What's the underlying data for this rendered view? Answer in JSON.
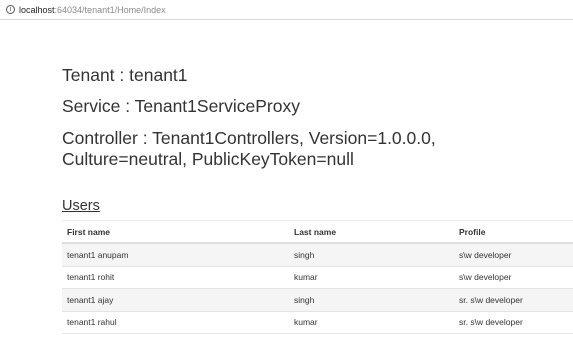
{
  "browser": {
    "url_host": "localhost",
    "url_rest": ":64034/tenant1/Home/Index",
    "info_icon": "info-icon"
  },
  "page": {
    "tenant_line": "Tenant : tenant1",
    "service_line": "Service : Tenant1ServiceProxy",
    "controller_line": "Controller : Tenant1Controllers, Version=1.0.0.0, Culture=neutral, PublicKeyToken=null",
    "users_heading": "Users"
  },
  "table": {
    "headers": [
      "First name",
      "Last name",
      "Profile"
    ],
    "rows": [
      [
        "tenant1 anupam",
        "singh",
        "s\\w developer"
      ],
      [
        "tenant1 rohit",
        "kumar",
        "s\\w developer"
      ],
      [
        "tenant1 ajay",
        "singh",
        "sr. s\\w developer"
      ],
      [
        "tenant1 rahul",
        "kumar",
        "sr. s\\w developer"
      ]
    ]
  }
}
